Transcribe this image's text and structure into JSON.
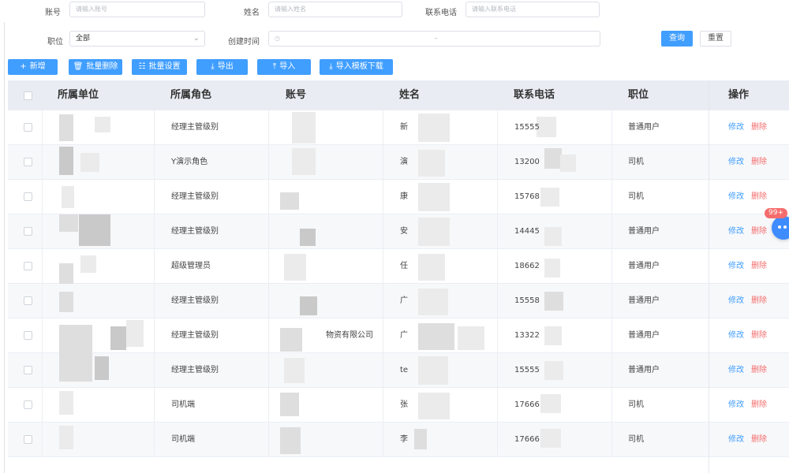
{
  "filters": {
    "account_label": "账号",
    "account_placeholder": "请输入账号",
    "name_label": "姓名",
    "name_placeholder": "请输入姓名",
    "phone_label": "联系电话",
    "phone_placeholder": "请输入联系电话",
    "position_label": "职位",
    "position_value": "全部",
    "created_label": "创建时间",
    "created_separator": "-",
    "query_button": "查询",
    "reset_button": "重置"
  },
  "toolbar": {
    "add": "新增",
    "batch_delete": "批量删除",
    "batch_settings": "批量设置",
    "export": "导出",
    "import": "导入",
    "import_template": "导入模板下载"
  },
  "table": {
    "headers": {
      "unit": "所属单位",
      "role": "所属角色",
      "account": "账号",
      "name": "姓名",
      "phone": "联系电话",
      "position": "职位",
      "actions": "操作"
    },
    "edit_label": "修改",
    "delete_label": "删除",
    "rows": [
      {
        "unit": "",
        "role": "经理主管级别",
        "account": "",
        "name": "新",
        "phone": "15555",
        "position": "普通用户"
      },
      {
        "unit": "",
        "role": "Y演示角色",
        "account": "",
        "name": "演",
        "phone": "13200",
        "position": "司机"
      },
      {
        "unit": "",
        "role": "经理主管级别",
        "account": "",
        "name": "康",
        "phone": "15768",
        "position": "司机"
      },
      {
        "unit": "",
        "role": "经理主管级别",
        "account": "",
        "name": "安",
        "phone": "14445",
        "position": "普通用户"
      },
      {
        "unit": "",
        "role": "超级管理员",
        "account": "",
        "name": "任",
        "phone": "18662",
        "position": "普通用户"
      },
      {
        "unit": "",
        "role": "经理主管级别",
        "account": "",
        "name": "广",
        "phone": "15558",
        "position": "普通用户"
      },
      {
        "unit": "",
        "role": "经理主管级别",
        "account": "物资有限公司",
        "name": "广",
        "phone": "13322",
        "position": "普通用户"
      },
      {
        "unit": "",
        "role": "经理主管级别",
        "account": "",
        "name": "te",
        "phone": "15555",
        "position": "普通用户"
      },
      {
        "unit": "",
        "role": "司机端",
        "account": "",
        "name": "张",
        "phone": "17666",
        "position": "司机"
      },
      {
        "unit": "",
        "role": "司机端",
        "account": "",
        "name": "李",
        "phone": "17666",
        "position": "司机"
      }
    ]
  },
  "float_widget": {
    "badge": "99+"
  }
}
